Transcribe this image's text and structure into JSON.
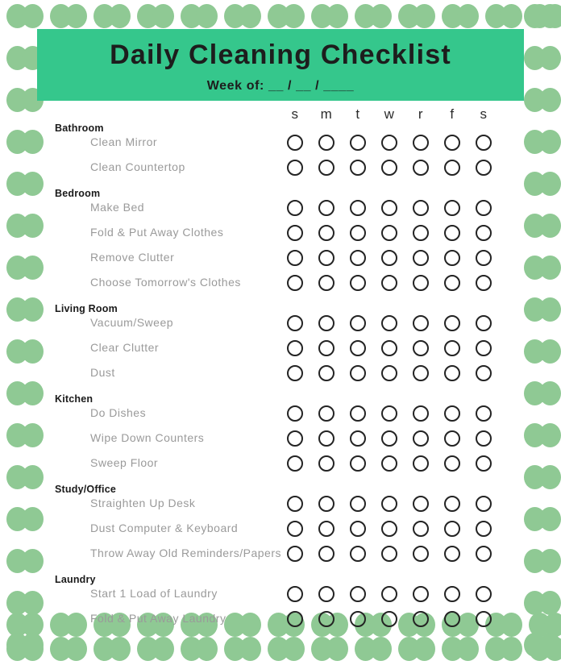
{
  "header": {
    "title": "Daily Cleaning Checklist",
    "subtitle": "Week of: __ / __ / ____",
    "banner_color": "#35c78c"
  },
  "decor": {
    "leaf_color": "#8fc994",
    "motif": "leaf-pair-icon"
  },
  "columns": {
    "day_labels": [
      "s",
      "m",
      "t",
      "w",
      "r",
      "f",
      "s"
    ]
  },
  "sections": [
    {
      "name": "Bathroom",
      "tasks": [
        "Clean Mirror",
        "Clean Countertop"
      ]
    },
    {
      "name": "Bedroom",
      "tasks": [
        "Make Bed",
        "Fold & Put Away Clothes",
        "Remove Clutter",
        "Choose Tomorrow's Clothes"
      ]
    },
    {
      "name": "Living Room",
      "tasks": [
        "Vacuum/Sweep",
        "Clear Clutter",
        "Dust"
      ]
    },
    {
      "name": "Kitchen",
      "tasks": [
        "Do Dishes",
        "Wipe Down Counters",
        "Sweep Floor"
      ]
    },
    {
      "name": "Study/Office",
      "tasks": [
        "Straighten Up Desk",
        "Dust Computer & Keyboard",
        "Throw Away Old Reminders/Papers"
      ]
    },
    {
      "name": "Laundry",
      "tasks": [
        "Start 1 Load of Laundry",
        "Fold & Put Away Laundry"
      ]
    }
  ]
}
